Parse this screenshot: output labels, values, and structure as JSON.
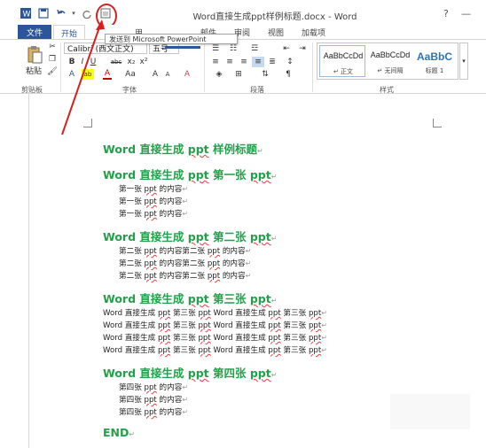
{
  "title_bar": {
    "title": "Word直接生成ppt样例标题.docx - Word",
    "help": "?",
    "minimize": "—"
  },
  "tabs": {
    "file": "文件",
    "home": "开始",
    "insert": "插入",
    "references": "用",
    "mailings": "邮件",
    "review": "审阅",
    "view": "视图",
    "addins": "加载项"
  },
  "tooltip": "发送到 Microsoft PowerPoint",
  "ribbon": {
    "clipboard": {
      "paste": "粘贴",
      "label": "剪贴板"
    },
    "font": {
      "font_name": "Calibri (西文正文)",
      "font_size": "五号",
      "label": "字体",
      "bold": "B",
      "italic": "I",
      "underline": "U",
      "strikethrough": "abc",
      "subscript": "x₂",
      "superscript": "x²",
      "change_case": "Aa",
      "grow": "A",
      "shrink": "A",
      "clear": "A",
      "font_color": "A",
      "highlight": "ab"
    },
    "paragraph": {
      "label": "段落"
    },
    "styles": {
      "label": "样式",
      "items": [
        {
          "preview": "AaBbCcDd",
          "name": "↵ 正文"
        },
        {
          "preview": "AaBbCcDd",
          "name": "↵ 无间隔"
        },
        {
          "preview": "AaBbC",
          "name": "标题 1"
        }
      ]
    }
  },
  "document": {
    "lines": [
      {
        "kind": "h",
        "parts": [
          "Word 直接生成 ",
          "ppt",
          " 样例标题"
        ]
      },
      {
        "kind": "h",
        "parts": [
          "Word 直接生成 ",
          "ppt",
          " 第一张 ",
          "ppt"
        ]
      },
      {
        "kind": "b",
        "parts": [
          "第一张 ",
          "ppt",
          " 的内容"
        ]
      },
      {
        "kind": "b",
        "parts": [
          "第一张 ",
          "ppt",
          " 的内容"
        ]
      },
      {
        "kind": "b",
        "parts": [
          "第一张 ",
          "ppt",
          " 的内容"
        ]
      },
      {
        "kind": "h",
        "parts": [
          "Word 直接生成 ",
          "ppt",
          " 第二张 ",
          "ppt"
        ]
      },
      {
        "kind": "b",
        "parts": [
          "第二张 ",
          "ppt",
          " 的内容第二张 ",
          "ppt",
          " 的内容"
        ]
      },
      {
        "kind": "b",
        "parts": [
          "第二张 ",
          "ppt",
          " 的内容第二张 ",
          "ppt",
          " 的内容"
        ]
      },
      {
        "kind": "b",
        "parts": [
          "第二张 ",
          "ppt",
          " 的内容第二张 ",
          "ppt",
          " 的内容"
        ]
      },
      {
        "kind": "h",
        "parts": [
          "Word 直接生成 ",
          "ppt",
          " 第三张 ",
          "ppt"
        ]
      },
      {
        "kind": "b",
        "parts": [
          "Word 直接生成 ",
          "ppt",
          " 第三张 ",
          "ppt",
          " Word 直接生成 ",
          "ppt",
          " 第三张 ",
          "ppt"
        ]
      },
      {
        "kind": "b",
        "parts": [
          "Word 直接生成 ",
          "ppt",
          " 第三张 ",
          "ppt",
          " Word 直接生成 ",
          "ppt",
          " 第三张 ",
          "ppt"
        ]
      },
      {
        "kind": "b",
        "parts": [
          "Word 直接生成 ",
          "ppt",
          " 第三张 ",
          "ppt",
          " Word 直接生成 ",
          "ppt",
          " 第三张 ",
          "ppt"
        ]
      },
      {
        "kind": "b",
        "parts": [
          "Word 直接生成 ",
          "ppt",
          " 第三张 ",
          "ppt",
          " Word 直接生成 ",
          "ppt",
          " 第三张 ",
          "ppt"
        ]
      },
      {
        "kind": "h",
        "parts": [
          "Word 直接生成 ",
          "ppt",
          " 第四张 ",
          "ppt"
        ]
      },
      {
        "kind": "b",
        "parts": [
          "第四张 ",
          "ppt",
          " 的内容"
        ]
      },
      {
        "kind": "b",
        "parts": [
          "第四张 ",
          "ppt",
          " 的内容"
        ]
      },
      {
        "kind": "b",
        "parts": [
          "第四张 ",
          "ppt",
          " 的内容"
        ]
      },
      {
        "kind": "h",
        "parts": [
          "END"
        ]
      }
    ]
  },
  "colors": {
    "accent": "#2b579a",
    "heading": "#22a14a",
    "annotation": "#d62020"
  }
}
